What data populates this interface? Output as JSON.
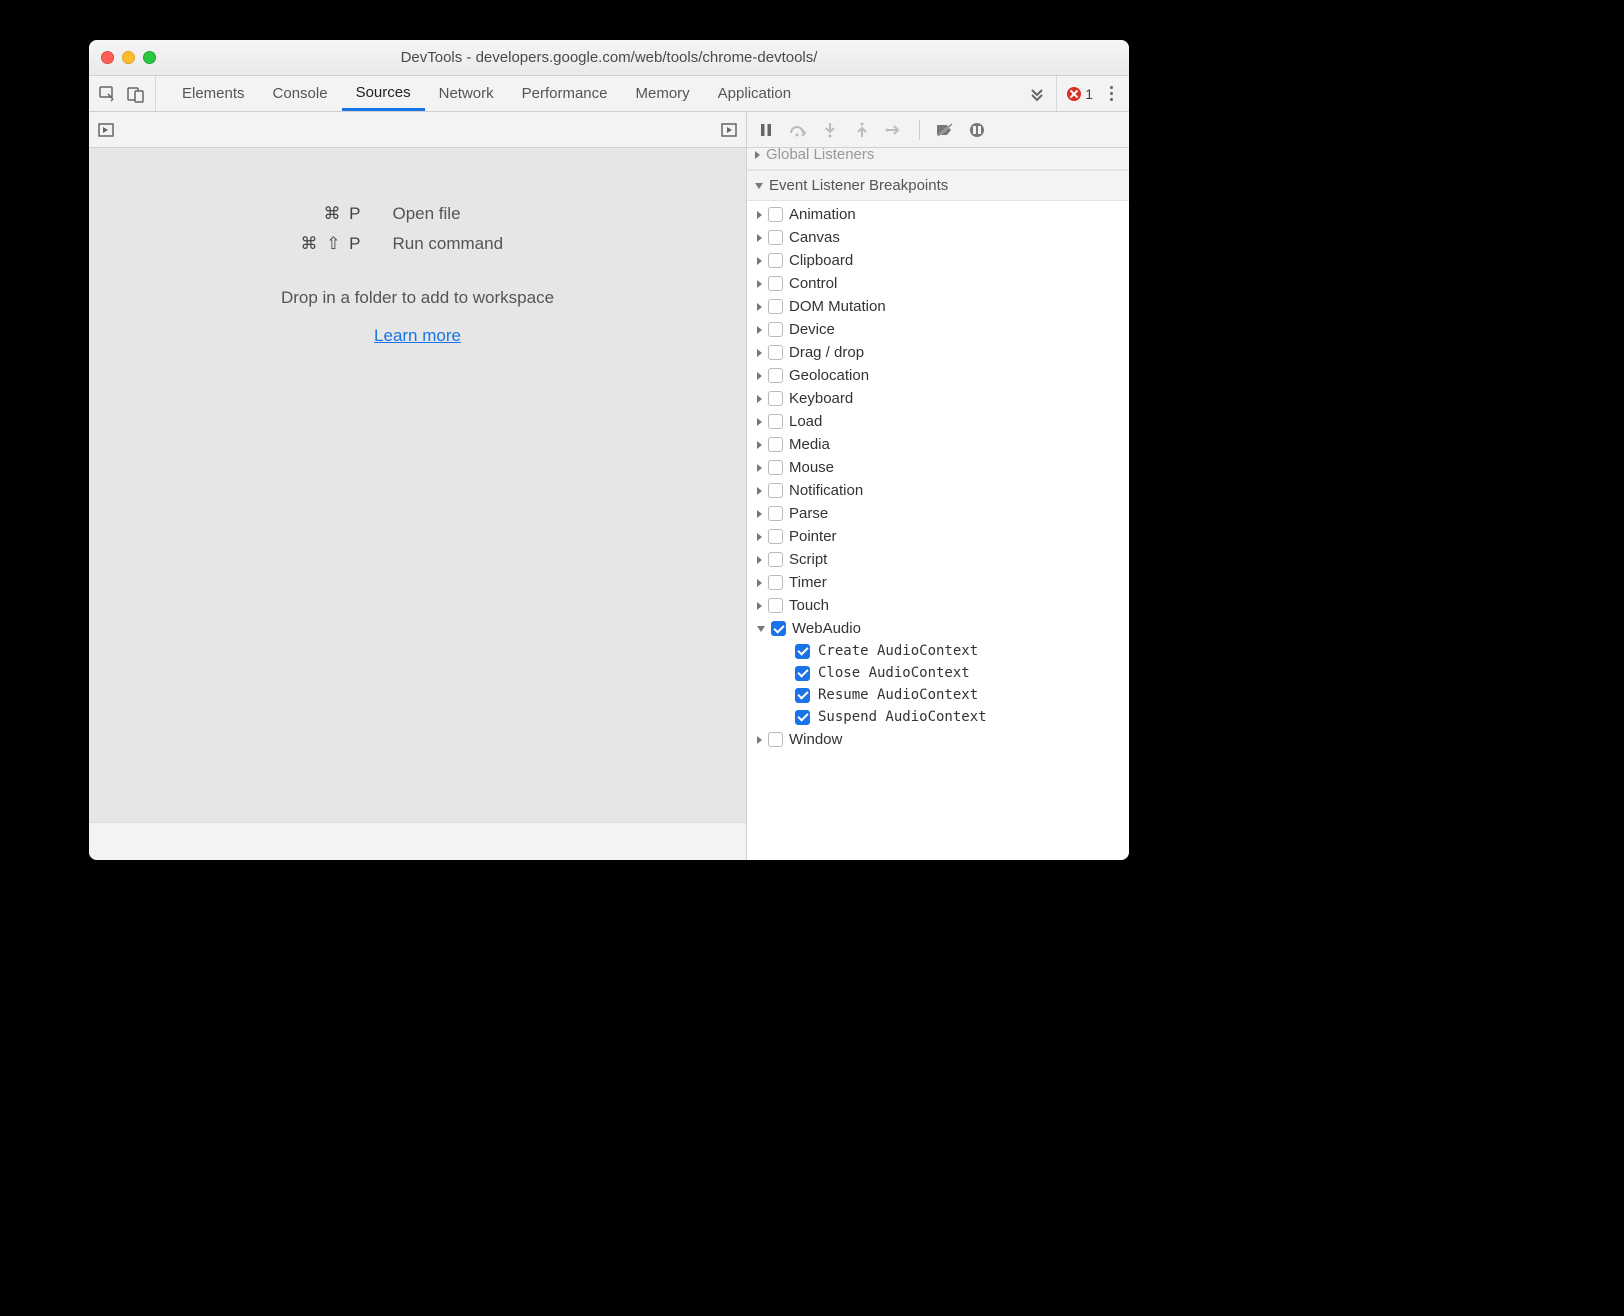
{
  "window": {
    "title": "DevTools - developers.google.com/web/tools/chrome-devtools/"
  },
  "tabs": {
    "items": [
      "Elements",
      "Console",
      "Sources",
      "Network",
      "Performance",
      "Memory",
      "Application"
    ],
    "active_index": 2,
    "error_count": "1"
  },
  "sources_placeholder": {
    "open_file_keys": "⌘ P",
    "open_file_label": "Open file",
    "run_cmd_keys": "⌘ ⇧ P",
    "run_cmd_label": "Run command",
    "drop_hint": "Drop in a folder to add to workspace",
    "learn_more": "Learn more"
  },
  "sidebar": {
    "global_listeners_title": "Global Listeners",
    "section_title": "Event Listener Breakpoints",
    "categories": [
      {
        "label": "Animation",
        "checked": false,
        "expanded": false
      },
      {
        "label": "Canvas",
        "checked": false,
        "expanded": false
      },
      {
        "label": "Clipboard",
        "checked": false,
        "expanded": false
      },
      {
        "label": "Control",
        "checked": false,
        "expanded": false
      },
      {
        "label": "DOM Mutation",
        "checked": false,
        "expanded": false
      },
      {
        "label": "Device",
        "checked": false,
        "expanded": false
      },
      {
        "label": "Drag / drop",
        "checked": false,
        "expanded": false
      },
      {
        "label": "Geolocation",
        "checked": false,
        "expanded": false
      },
      {
        "label": "Keyboard",
        "checked": false,
        "expanded": false
      },
      {
        "label": "Load",
        "checked": false,
        "expanded": false
      },
      {
        "label": "Media",
        "checked": false,
        "expanded": false
      },
      {
        "label": "Mouse",
        "checked": false,
        "expanded": false
      },
      {
        "label": "Notification",
        "checked": false,
        "expanded": false
      },
      {
        "label": "Parse",
        "checked": false,
        "expanded": false
      },
      {
        "label": "Pointer",
        "checked": false,
        "expanded": false
      },
      {
        "label": "Script",
        "checked": false,
        "expanded": false
      },
      {
        "label": "Timer",
        "checked": false,
        "expanded": false
      },
      {
        "label": "Touch",
        "checked": false,
        "expanded": false
      },
      {
        "label": "WebAudio",
        "checked": true,
        "expanded": true,
        "children": [
          {
            "label": "Create AudioContext",
            "checked": true
          },
          {
            "label": "Close AudioContext",
            "checked": true
          },
          {
            "label": "Resume AudioContext",
            "checked": true
          },
          {
            "label": "Suspend AudioContext",
            "checked": true
          }
        ]
      },
      {
        "label": "Window",
        "checked": false,
        "expanded": false
      }
    ]
  }
}
